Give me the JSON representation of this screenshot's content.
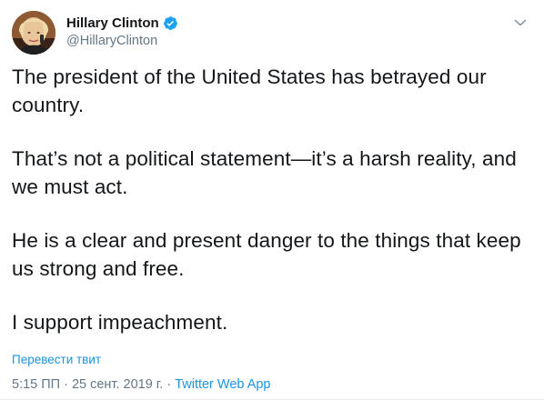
{
  "tweet": {
    "display_name": "Hillary Clinton",
    "handle": "@HillaryClinton",
    "verified": true,
    "paragraphs": [
      "The president of the United States has betrayed our country.",
      "That’s not a political statement—it’s a harsh reality, and we must act.",
      "He is a clear and present danger to the things that keep us strong and free.",
      "I support impeachment."
    ],
    "translate_label": "Перевести твит",
    "time": "5:15 ПП",
    "date": "25 сент. 2019 г.",
    "separator": "·",
    "source": "Twitter Web App"
  },
  "icons": {
    "verified": "verified-badge-icon",
    "caret": "chevron-down-icon"
  },
  "colors": {
    "text": "#14171a",
    "secondary": "#657786",
    "link": "#1b95e0",
    "verified": "#1da1f2"
  }
}
